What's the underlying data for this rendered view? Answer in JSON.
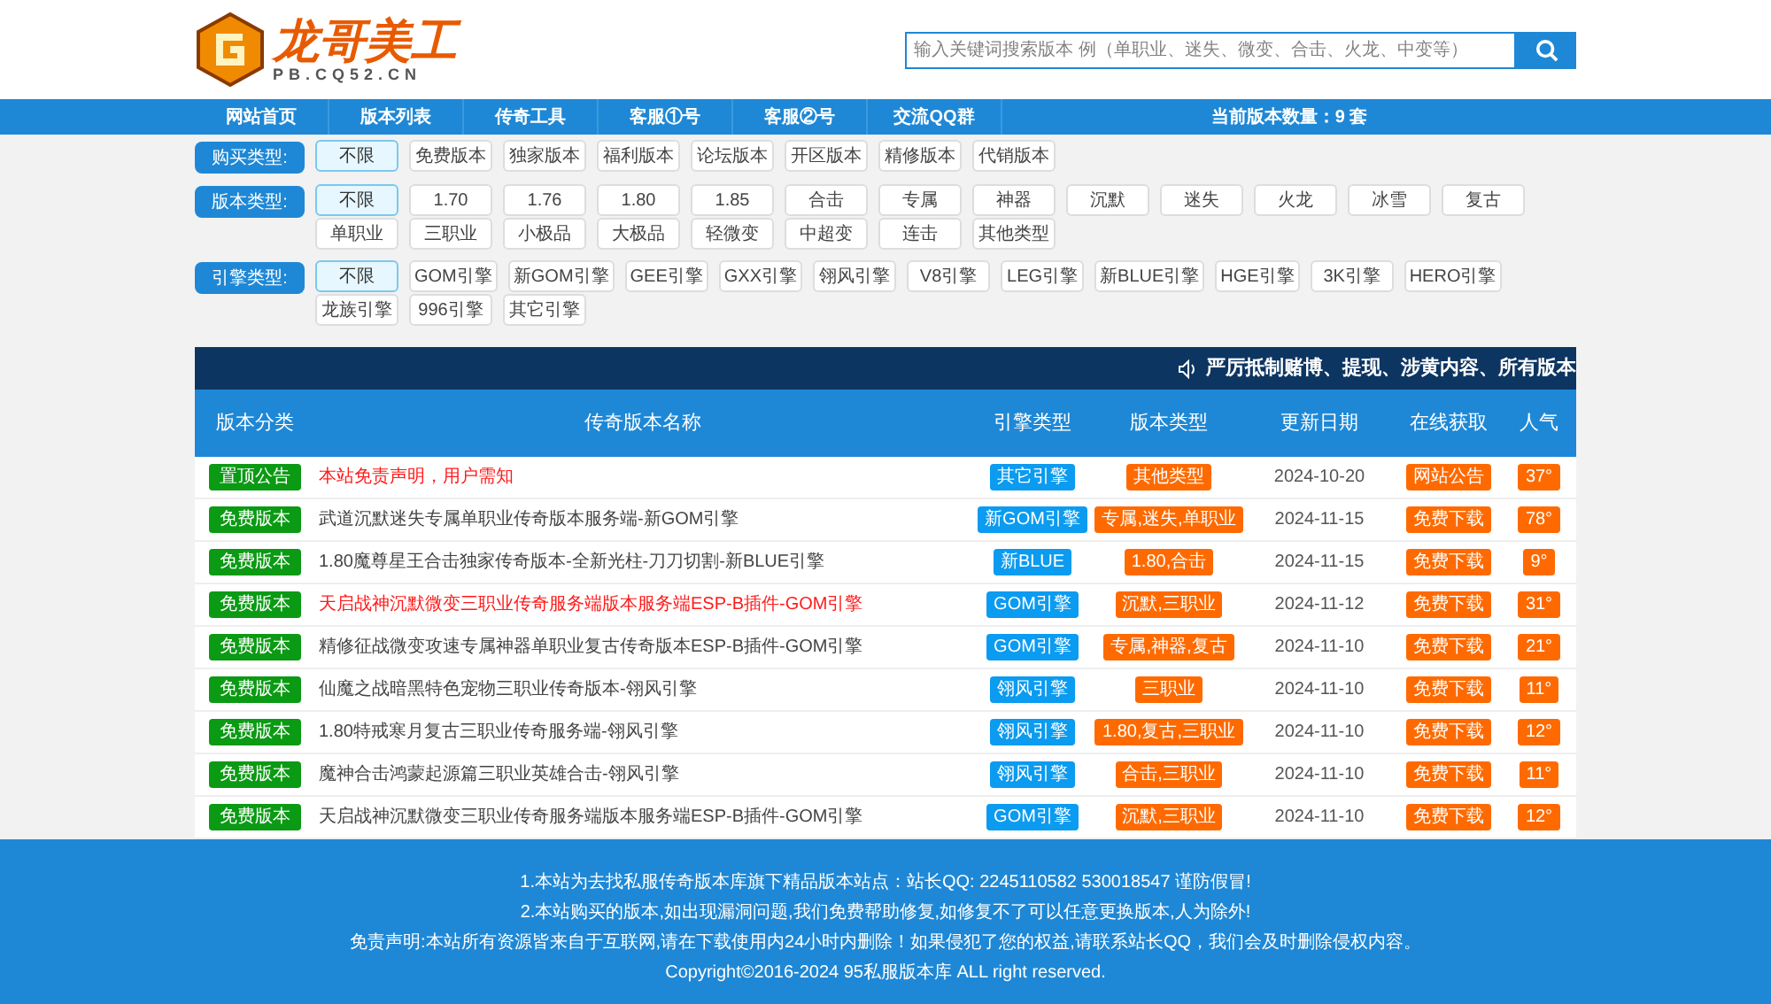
{
  "logo": {
    "title": "龙哥美工",
    "subtitle": "PB.CQ52.CN"
  },
  "search": {
    "placeholder": "输入关键词搜索版本 例（单职业、迷失、微变、合击、火龙、中变等）"
  },
  "nav": [
    "网站首页",
    "版本列表",
    "传奇工具",
    "客服①号",
    "客服②号",
    "交流QQ群",
    "当前版本数量：9 套"
  ],
  "filters": [
    {
      "label": "购买类型:",
      "options": [
        {
          "label": "不限",
          "selected": true
        },
        {
          "label": "免费版本",
          "selected": false
        },
        {
          "label": "独家版本",
          "selected": false
        },
        {
          "label": "福利版本",
          "selected": false
        },
        {
          "label": "论坛版本",
          "selected": false
        },
        {
          "label": "开区版本",
          "selected": false
        },
        {
          "label": "精修版本",
          "selected": false
        },
        {
          "label": "代销版本",
          "selected": false
        }
      ]
    },
    {
      "label": "版本类型:",
      "options": [
        {
          "label": "不限",
          "selected": true
        },
        {
          "label": "1.70",
          "selected": false
        },
        {
          "label": "1.76",
          "selected": false
        },
        {
          "label": "1.80",
          "selected": false
        },
        {
          "label": "1.85",
          "selected": false
        },
        {
          "label": "合击",
          "selected": false
        },
        {
          "label": "专属",
          "selected": false
        },
        {
          "label": "神器",
          "selected": false
        },
        {
          "label": "沉默",
          "selected": false
        },
        {
          "label": "迷失",
          "selected": false
        },
        {
          "label": "火龙",
          "selected": false
        },
        {
          "label": "冰雪",
          "selected": false
        },
        {
          "label": "复古",
          "selected": false
        },
        {
          "label": "单职业",
          "selected": false
        },
        {
          "label": "三职业",
          "selected": false
        },
        {
          "label": "小极品",
          "selected": false
        },
        {
          "label": "大极品",
          "selected": false
        },
        {
          "label": "轻微变",
          "selected": false
        },
        {
          "label": "中超变",
          "selected": false
        },
        {
          "label": "连击",
          "selected": false
        },
        {
          "label": "其他类型",
          "selected": false
        }
      ]
    },
    {
      "label": "引擎类型:",
      "options": [
        {
          "label": "不限",
          "selected": true
        },
        {
          "label": "GOM引擎",
          "selected": false
        },
        {
          "label": "新GOM引擎",
          "selected": false
        },
        {
          "label": "GEE引擎",
          "selected": false
        },
        {
          "label": "GXX引擎",
          "selected": false
        },
        {
          "label": "翎风引擎",
          "selected": false
        },
        {
          "label": "V8引擎",
          "selected": false
        },
        {
          "label": "LEG引擎",
          "selected": false
        },
        {
          "label": "新BLUE引擎",
          "selected": false
        },
        {
          "label": "HGE引擎",
          "selected": false
        },
        {
          "label": "3K引擎",
          "selected": false
        },
        {
          "label": "HERO引擎",
          "selected": false
        },
        {
          "label": "龙族引擎",
          "selected": false
        },
        {
          "label": "996引擎",
          "selected": false
        },
        {
          "label": "其它引擎",
          "selected": false
        }
      ]
    }
  ],
  "notice": "严厉抵制赌博、提现、涉黄内容、所有版本",
  "table": {
    "columns": [
      "版本分类",
      "传奇版本名称",
      "引擎类型",
      "版本类型",
      "更新日期",
      "在线获取",
      "人气"
    ],
    "rows": [
      {
        "category": "置顶公告",
        "name": "本站免责声明，用户需知",
        "highlight": true,
        "engine": "其它引擎",
        "type": "其他类型",
        "date": "2024-10-20",
        "action": "网站公告",
        "popularity": "37°"
      },
      {
        "category": "免费版本",
        "name": "武道沉默迷失专属单职业传奇版本服务端-新GOM引擎",
        "highlight": false,
        "engine": "新GOM引擎",
        "type": "专属,迷失,单职业",
        "date": "2024-11-15",
        "action": "免费下载",
        "popularity": "78°"
      },
      {
        "category": "免费版本",
        "name": "1.80魔尊星王合击独家传奇版本-全新光柱-刀刀切割-新BLUE引擎",
        "highlight": false,
        "engine": "新BLUE",
        "type": "1.80,合击",
        "date": "2024-11-15",
        "action": "免费下载",
        "popularity": "9°"
      },
      {
        "category": "免费版本",
        "name": "天启战神沉默微变三职业传奇服务端版本服务端ESP-B插件-GOM引擎",
        "highlight": true,
        "engine": "GOM引擎",
        "type": "沉默,三职业",
        "date": "2024-11-12",
        "action": "免费下载",
        "popularity": "31°"
      },
      {
        "category": "免费版本",
        "name": "精修征战微变攻速专属神器单职业复古传奇版本ESP-B插件-GOM引擎",
        "highlight": false,
        "engine": "GOM引擎",
        "type": "专属,神器,复古",
        "date": "2024-11-10",
        "action": "免费下载",
        "popularity": "21°"
      },
      {
        "category": "免费版本",
        "name": "仙魔之战暗黑特色宠物三职业传奇版本-翎风引擎",
        "highlight": false,
        "engine": "翎风引擎",
        "type": "三职业",
        "date": "2024-11-10",
        "action": "免费下载",
        "popularity": "11°"
      },
      {
        "category": "免费版本",
        "name": "1.80特戒寒月复古三职业传奇服务端-翎风引擎",
        "highlight": false,
        "engine": "翎风引擎",
        "type": "1.80,复古,三职业",
        "date": "2024-11-10",
        "action": "免费下载",
        "popularity": "12°"
      },
      {
        "category": "免费版本",
        "name": "魔神合击鸿蒙起源篇三职业英雄合击-翎风引擎",
        "highlight": false,
        "engine": "翎风引擎",
        "type": "合击,三职业",
        "date": "2024-11-10",
        "action": "免费下载",
        "popularity": "11°"
      },
      {
        "category": "免费版本",
        "name": "天启战神沉默微变三职业传奇服务端版本服务端ESP-B插件-GOM引擎",
        "highlight": false,
        "engine": "GOM引擎",
        "type": "沉默,三职业",
        "date": "2024-11-10",
        "action": "免费下载",
        "popularity": "12°"
      }
    ]
  },
  "footer": [
    "1.本站为去找私服传奇版本库旗下精品版本站点：站长QQ: 2245110582 530018547 谨防假冒!",
    "2.本站购买的版本,如出现漏洞问题,我们免费帮助修复,如修复不了可以任意更换版本,人为除外!",
    "免责声明:本站所有资源皆来自于互联网,请在下载使用内24小时内删除！如果侵犯了您的权益,请联系站长QQ，我们会及时删除侵权内容。",
    "Copyright©2016-2024 95私服版本库 ALL right reserved."
  ]
}
